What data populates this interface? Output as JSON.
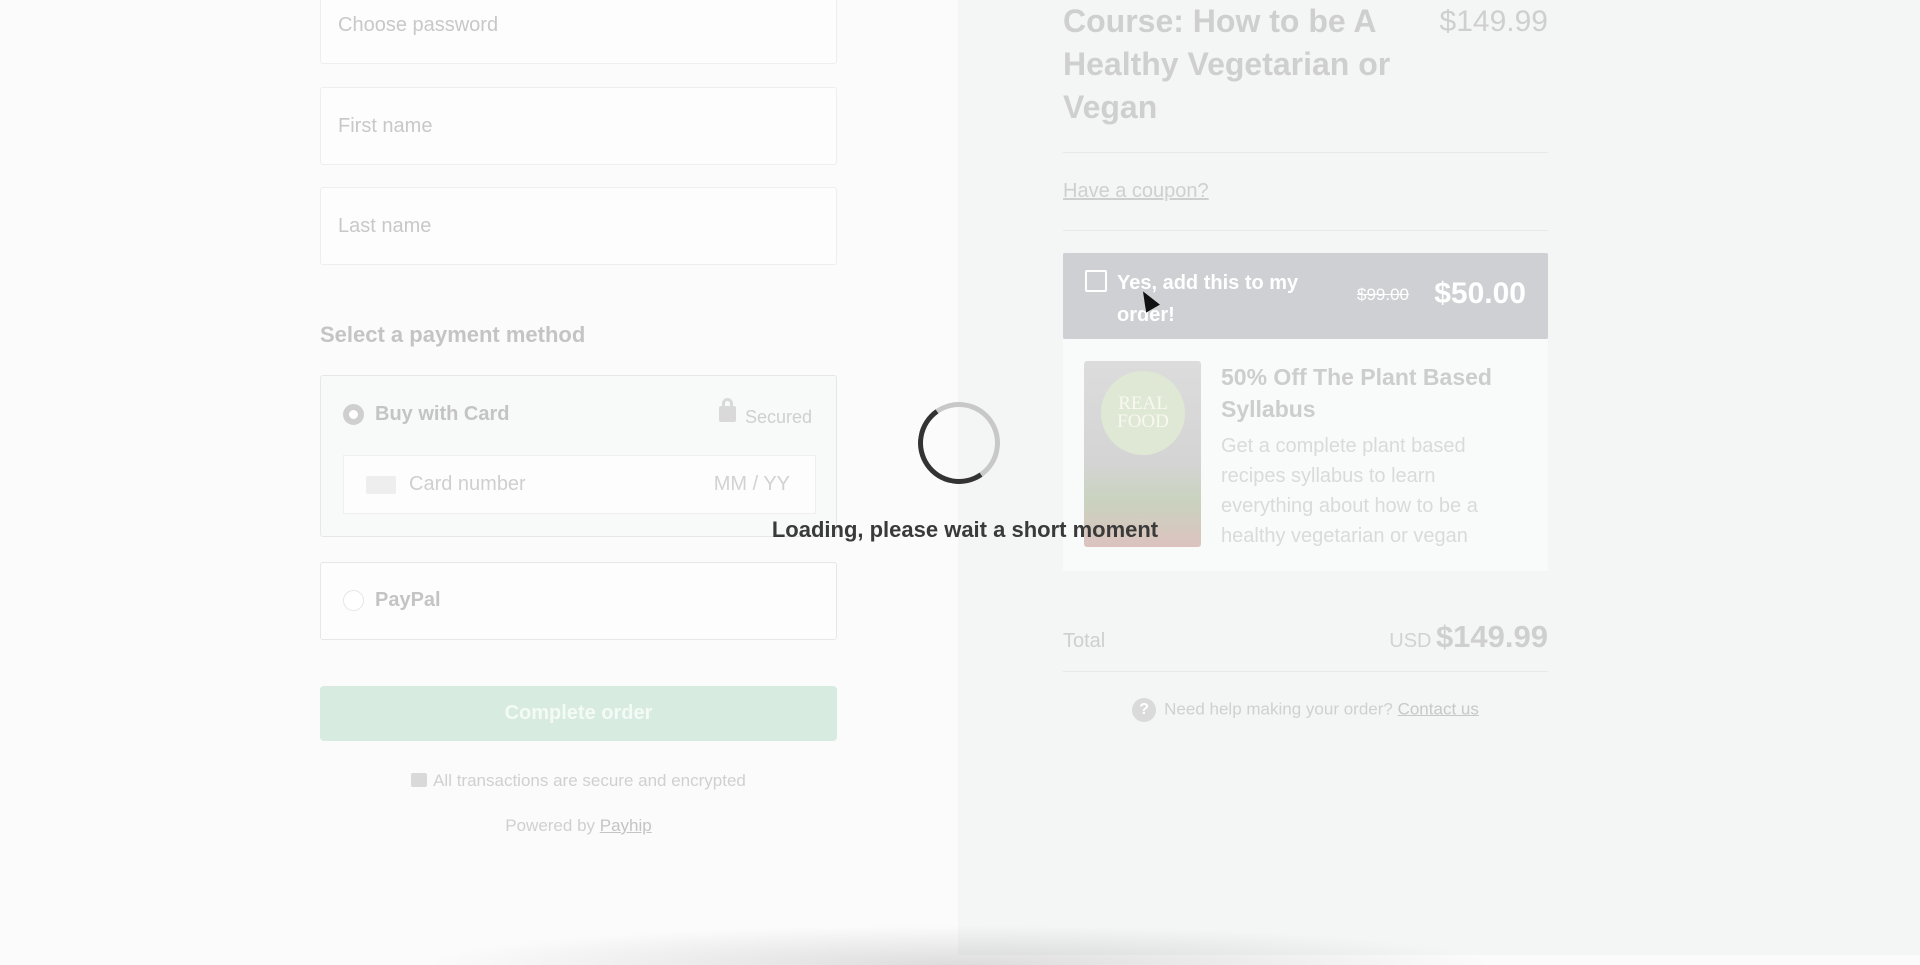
{
  "form": {
    "password_placeholder": "Choose password",
    "first_name_placeholder": "First name",
    "last_name_placeholder": "Last name"
  },
  "payment": {
    "heading": "Select a payment method",
    "card_label": "Buy with Card",
    "secured_label": "Secured",
    "card_number_placeholder": "Card number",
    "expiry_placeholder": "MM / YY",
    "paypal_label": "PayPal",
    "complete_button": "Complete order",
    "secure_note": "All transactions are secure and encrypted",
    "powered_by": "Powered by",
    "powered_by_link": "Payhip"
  },
  "order": {
    "title": "Course: How to be A Healthy Vegetarian or Vegan",
    "price": "$149.99",
    "coupon_link": "Have a coupon?",
    "upsell": {
      "checkbox_label": "Yes, add this to my order!",
      "old_price": "$99.00",
      "new_price": "$50.00",
      "image_text": "REAL FOOD",
      "product_title": "50% Off The Plant Based Syllabus",
      "product_description": "Get a complete plant based recipes syllabus to learn everything about how to be a healthy vegetarian or vegan"
    },
    "total_label": "Total",
    "total_currency": "USD",
    "total_amount": "$149.99",
    "help_text": "Need help making your order?",
    "contact_link": "Contact us"
  },
  "loading": {
    "message": "Loading, please wait a short moment"
  }
}
